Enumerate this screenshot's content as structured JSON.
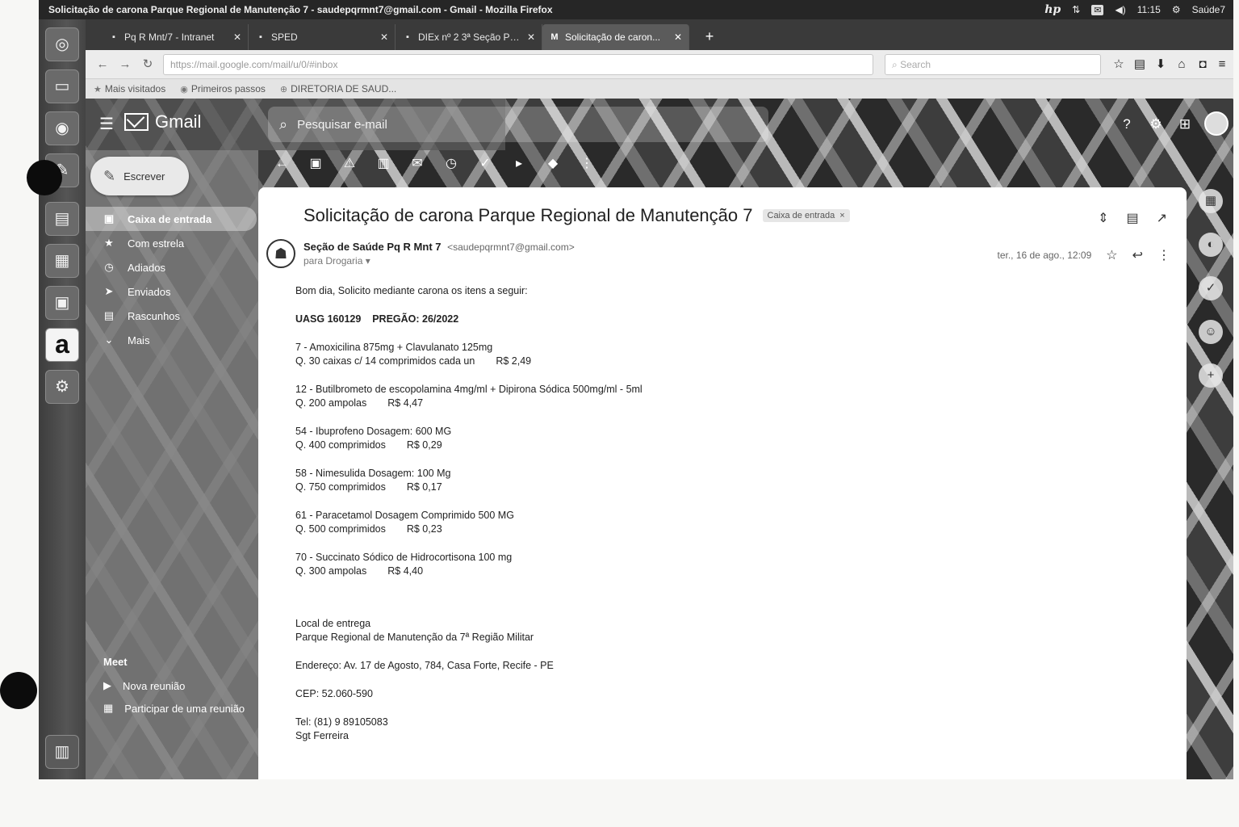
{
  "window": {
    "title": "Solicitação de carona Parque Regional de Manutenção 7 - saudepqrmnt7@gmail.com - Gmail - Mozilla Firefox"
  },
  "system_tray": {
    "hp_logo": "hp",
    "clock": "11:15",
    "user": "Saúde7"
  },
  "launcher": {
    "icons": [
      "ubuntu-dash-icon",
      "files-icon",
      "firefox-icon",
      "text-editor-icon",
      "libreoffice-writer-icon",
      "libreoffice-calc-icon",
      "libreoffice-impress-icon",
      "amazon-icon",
      "system-settings-icon",
      "trash-icon"
    ],
    "amazon_letter": "a"
  },
  "tabs": [
    {
      "label": "Pq R Mnt/7 - Intranet",
      "icon": "intranet-favicon"
    },
    {
      "label": "SPED",
      "icon": "sped-favicon"
    },
    {
      "label": "DIEx nº 2 3ª Seção Pq...",
      "icon": "diex-favicon"
    },
    {
      "label": "Solicitação de caron...",
      "icon": "gmail-favicon",
      "active": true
    }
  ],
  "urlbar": {
    "url": "https://mail.google.com/mail/u/0/#inbox",
    "search_placeholder": "Search"
  },
  "bookmarks": [
    "Mais visitados",
    "Primeiros passos",
    "DIRETORIA DE SAUD..."
  ],
  "gmail": {
    "logo": "Gmail",
    "search_placeholder": "Pesquisar e-mail",
    "compose": "Escrever",
    "nav": [
      {
        "label": "Caixa de entrada",
        "icon": "inbox-icon",
        "active": true
      },
      {
        "label": "Com estrela",
        "icon": "star-icon"
      },
      {
        "label": "Adiados",
        "icon": "snooze-icon"
      },
      {
        "label": "Enviados",
        "icon": "send-icon"
      },
      {
        "label": "Rascunhos",
        "icon": "draft-icon"
      },
      {
        "label": "Mais",
        "icon": "expand-more-icon"
      }
    ],
    "meet": {
      "heading": "Meet",
      "items": [
        "Nova reunião",
        "Participar de uma reunião"
      ]
    },
    "toolbar_icons": [
      "back-icon",
      "archive-icon",
      "report-spam-icon",
      "delete-icon",
      "mark-unread-icon",
      "snooze-icon",
      "add-task-icon",
      "move-to-icon",
      "label-icon",
      "more-icon"
    ],
    "side_panel_icons": [
      "calendar-icon",
      "keep-icon",
      "tasks-icon",
      "contacts-icon",
      "add-addon-icon"
    ]
  },
  "email": {
    "subject": "Solicitação de carona Parque Regional de Manutenção 7",
    "label_chip": "Caixa de entrada",
    "sender_name": "Seção de Saúde Pq R Mnt 7",
    "sender_email": "<saudepqrmnt7@gmail.com>",
    "recipient": "para Drogaria",
    "date": "ter., 16 de ago., 12:09",
    "greeting": "Bom dia, Solicito mediante carona os itens a seguir:",
    "uasg": "UASG 160129",
    "pregao": "PREGÃO: 26/2022",
    "items": [
      {
        "title": "7 - Amoxicilina 875mg + Clavulanato 125mg",
        "qty": "Q. 30 caixas c/ 14 comprimidos cada  un",
        "price": "R$ 2,49"
      },
      {
        "title": "12 - Butilbrometo de escopolamina 4mg/ml + Dipirona Sódica 500mg/ml - 5ml",
        "qty": "Q. 200 ampolas",
        "price": "R$ 4,47"
      },
      {
        "title": "54 - Ibuprofeno Dosagem: 600 MG",
        "qty": "Q. 400 comprimidos",
        "price": "R$ 0,29"
      },
      {
        "title": "58 - Nimesulida Dosagem: 100 Mg",
        "qty": "Q. 750 comprimidos",
        "price": "R$ 0,17"
      },
      {
        "title": "61 - Paracetamol Dosagem Comprimido 500 MG",
        "qty": "Q. 500 comprimidos",
        "price": "R$ 0,23"
      },
      {
        "title": "70 - Succinato Sódico de Hidrocortisona 100 mg",
        "qty": "Q. 300 ampolas",
        "price": "R$ 4,40"
      }
    ],
    "delivery": {
      "heading": "Local de entrega",
      "place": "Parque Regional de Manutenção da 7ª Região Militar",
      "address": "Endereço: Av. 17 de Agosto, 784, Casa Forte, Recife - PE",
      "cep": "CEP: 52.060-590",
      "phone": "Tel: (81) 9 89105083",
      "signature": "Sgt Ferreira"
    }
  },
  "colors": {
    "panel": "#262626",
    "launcher": "#4a4a4a",
    "card": "#ffffff",
    "text": "#1e1e1e"
  }
}
